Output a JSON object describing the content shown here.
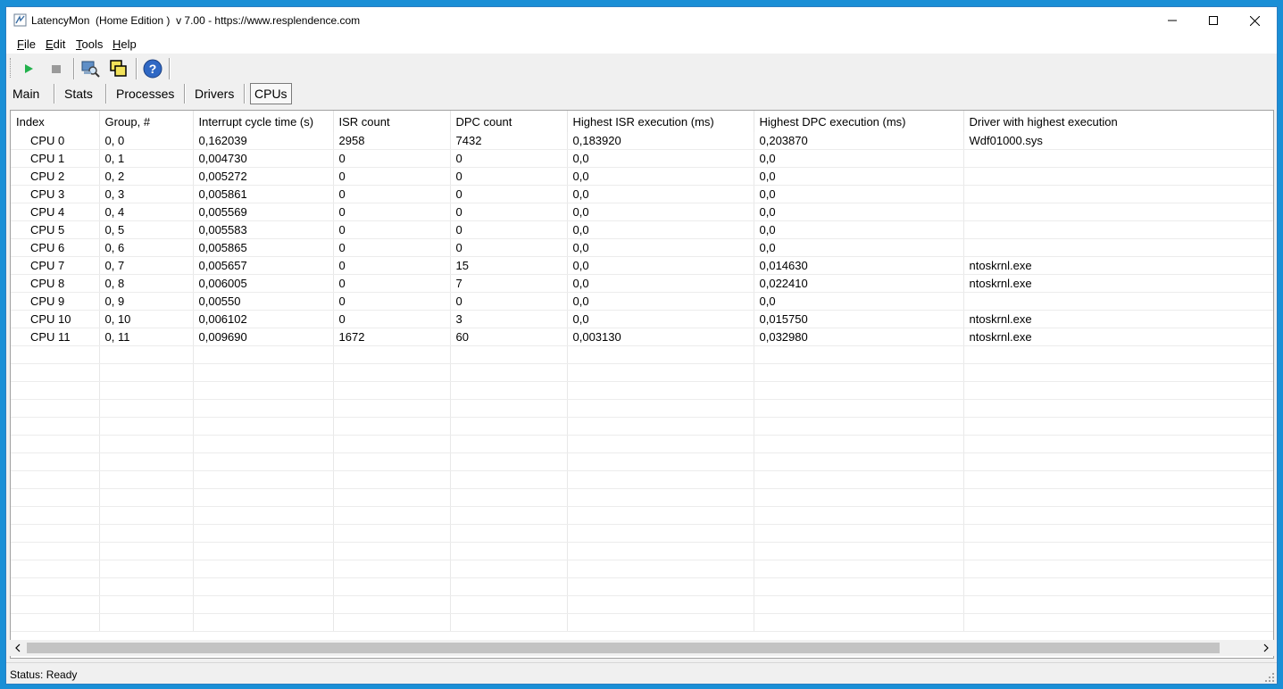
{
  "window": {
    "title": "LatencyMon  (Home Edition )  v 7.00 - https://www.resplendence.com"
  },
  "menu": {
    "items": [
      {
        "label_u": "F",
        "label_rest": "ile"
      },
      {
        "label_u": "E",
        "label_rest": "dit"
      },
      {
        "label_u": "T",
        "label_rest": "ools"
      },
      {
        "label_u": "H",
        "label_rest": "elp"
      }
    ]
  },
  "toolbar": {
    "icons": [
      "start-icon",
      "stop-icon",
      "analyze-icon",
      "windows-icon",
      "help-icon"
    ]
  },
  "tabs": [
    {
      "label": "Main",
      "active": false
    },
    {
      "label": "Stats",
      "active": false
    },
    {
      "label": "Processes",
      "active": false
    },
    {
      "label": "Drivers",
      "active": false
    },
    {
      "label": "CPUs",
      "active": true
    }
  ],
  "grid": {
    "columns": [
      "Index",
      "Group, #",
      "Interrupt cycle time (s)",
      "ISR count",
      "DPC count",
      "Highest ISR execution (ms)",
      "Highest DPC execution (ms)",
      "Driver with highest execution"
    ],
    "rows": [
      [
        "CPU 0",
        "0, 0",
        "0,162039",
        "2958",
        "7432",
        "0,183920",
        "0,203870",
        "Wdf01000.sys"
      ],
      [
        "CPU 1",
        "0, 1",
        "0,004730",
        "0",
        "0",
        "0,0",
        "0,0",
        ""
      ],
      [
        "CPU 2",
        "0, 2",
        "0,005272",
        "0",
        "0",
        "0,0",
        "0,0",
        ""
      ],
      [
        "CPU 3",
        "0, 3",
        "0,005861",
        "0",
        "0",
        "0,0",
        "0,0",
        ""
      ],
      [
        "CPU 4",
        "0, 4",
        "0,005569",
        "0",
        "0",
        "0,0",
        "0,0",
        ""
      ],
      [
        "CPU 5",
        "0, 5",
        "0,005583",
        "0",
        "0",
        "0,0",
        "0,0",
        ""
      ],
      [
        "CPU 6",
        "0, 6",
        "0,005865",
        "0",
        "0",
        "0,0",
        "0,0",
        ""
      ],
      [
        "CPU 7",
        "0, 7",
        "0,005657",
        "0",
        "15",
        "0,0",
        "0,014630",
        "ntoskrnl.exe"
      ],
      [
        "CPU 8",
        "0, 8",
        "0,006005",
        "0",
        "7",
        "0,0",
        "0,022410",
        "ntoskrnl.exe"
      ],
      [
        "CPU 9",
        "0, 9",
        "0,00550",
        "0",
        "0",
        "0,0",
        "0,0",
        ""
      ],
      [
        "CPU 10",
        "0, 10",
        "0,006102",
        "0",
        "3",
        "0,0",
        "0,015750",
        "ntoskrnl.exe"
      ],
      [
        "CPU 11",
        "0, 11",
        "0,009690",
        "1672",
        "60",
        "0,003130",
        "0,032980",
        "ntoskrnl.exe"
      ]
    ],
    "empty_rows": 16
  },
  "status": {
    "text": "Status: Ready"
  },
  "colors": {
    "desktop": "#1a8fd6",
    "start_green": "#22b14c"
  }
}
